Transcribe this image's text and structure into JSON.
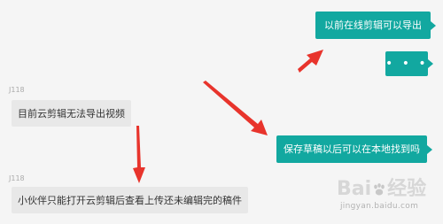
{
  "messages": [
    {
      "direction": "out",
      "text": "以前在线剪辑可以导出"
    },
    {
      "direction": "out",
      "text": "• • •"
    },
    {
      "direction": "out",
      "text": "保存草稿以后可以在本地找到吗"
    },
    {
      "direction": "in",
      "sender": "J118",
      "text": "目前云剪辑无法导出视频"
    },
    {
      "direction": "in",
      "sender": "J118",
      "text": "小伙伴只能打开云剪辑后查看上传还未编辑完的稿件"
    }
  ],
  "watermark": {
    "brand_left": "Bai",
    "brand_right": "经验",
    "url": "jingyan.baidu.com"
  },
  "colors": {
    "outgoing_bubble": "#12a8a0",
    "incoming_bubble": "#e8e8e8",
    "annotation_arrow": "#e8342c",
    "background": "#f5f5f5"
  }
}
